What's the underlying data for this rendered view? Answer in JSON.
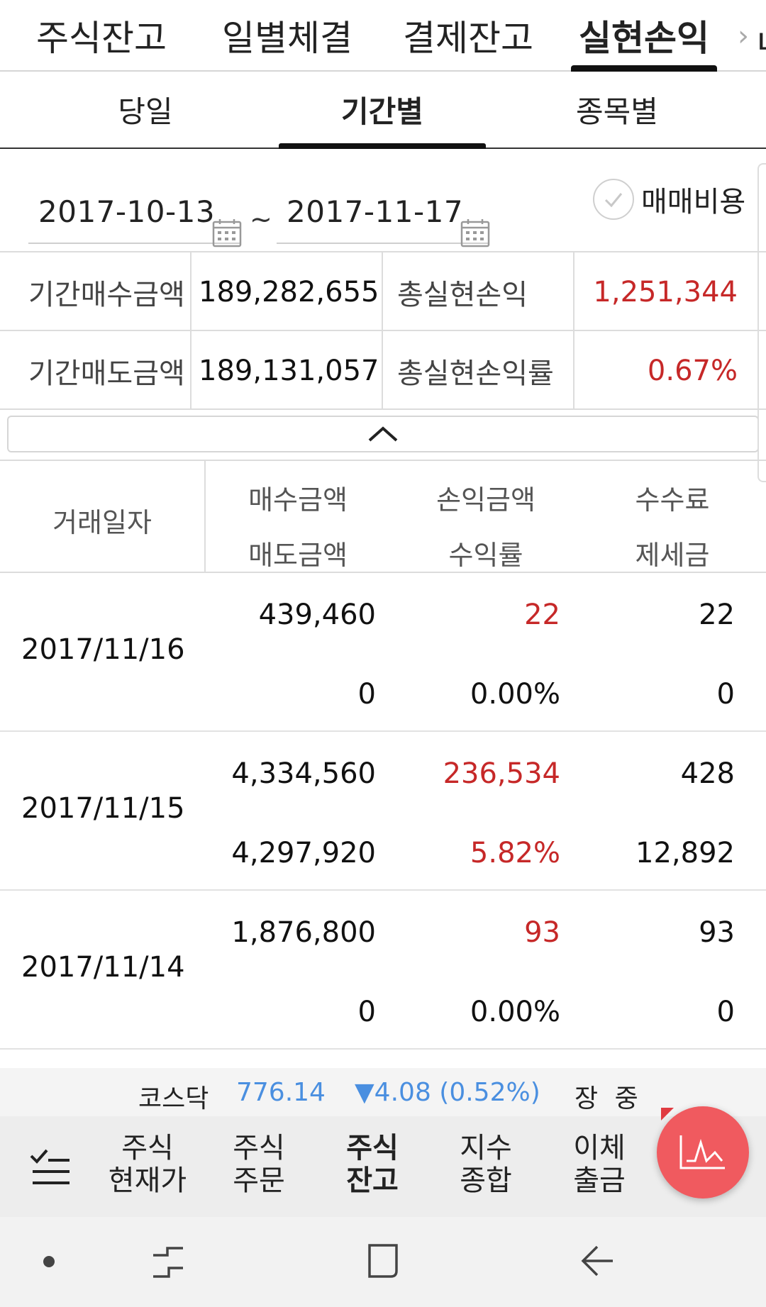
{
  "top_tabs": [
    "주식잔고",
    "일별체결",
    "결제잔고",
    "실현손익"
  ],
  "top_tabs_more": "›",
  "top_tab_edge": "ㄴ",
  "sub_tabs": [
    "당일",
    "기간별",
    "종목별"
  ],
  "date_range": {
    "start": "2017-10-13",
    "end": "2017-11-17",
    "separator": "~"
  },
  "fee_toggle": {
    "label": "매매비용",
    "checked": false
  },
  "summary": {
    "buy_label": "기간매수금액",
    "buy_value": "189,282,655",
    "sell_label": "기간매도금액",
    "sell_value": "189,131,057",
    "pl_label": "총실현손익",
    "pl_value": "1,251,344",
    "rate_label": "총실현손익률",
    "rate_value": "0.67%"
  },
  "table_header": {
    "date": "거래일자",
    "buy": "매수금액",
    "sell": "매도금액",
    "pl": "손익금액",
    "rate": "수익률",
    "fee": "수수료",
    "tax": "제세금"
  },
  "rows": [
    {
      "date": "2017/11/16",
      "buy": "439,460",
      "sell": "0",
      "pl": "22",
      "rate": "0.00%",
      "fee": "22",
      "tax": "0"
    },
    {
      "date": "2017/11/15",
      "buy": "4,334,560",
      "sell": "4,297,920",
      "pl": "236,534",
      "rate": "5.82%",
      "fee": "428",
      "tax": "12,892"
    },
    {
      "date": "2017/11/14",
      "buy": "1,876,800",
      "sell": "0",
      "pl": "93",
      "rate": "0.00%",
      "fee": "93",
      "tax": "0"
    }
  ],
  "ticker": {
    "name": "코스닥",
    "value": "776.14",
    "change": "▼4.08 (0.52%)",
    "status": "장 중"
  },
  "bottom_nav": [
    "주식\n현재가",
    "주식\n주문",
    "주식\n잔고",
    "지수\n종합",
    "이체\n출금"
  ],
  "colors": {
    "positive": "#c62828",
    "index_blue": "#4a8fe0",
    "fab": "#f05a5f"
  }
}
